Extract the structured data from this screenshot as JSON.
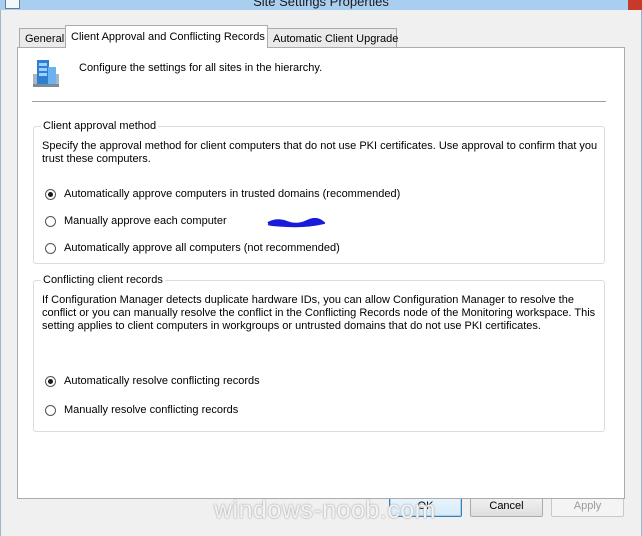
{
  "window": {
    "title": "Site Settings Properties"
  },
  "tabs": [
    {
      "label": "General",
      "active": false
    },
    {
      "label": "Client Approval and Conflicting Records",
      "active": true
    },
    {
      "label": "Automatic Client Upgrade",
      "active": false
    }
  ],
  "header": {
    "icon": "site-settings-icon",
    "text": "Configure the settings for all sites in the hierarchy."
  },
  "approval": {
    "title": "Client approval method",
    "description": "Specify the approval method for client computers that do not use PKI certificates. Use approval to confirm that you trust these computers.",
    "options": [
      {
        "label": "Automatically approve computers in trusted domains (recommended)",
        "checked": true
      },
      {
        "label": "Manually approve each computer",
        "checked": false
      },
      {
        "label": "Automatically approve all computers (not recommended)",
        "checked": false
      }
    ]
  },
  "conflicting": {
    "title": "Conflicting client records",
    "description": "If Configuration Manager detects duplicate hardware IDs, you can allow Configuration Manager to resolve the conflict or you can manually resolve the conflict in the Conflicting Records node of the Monitoring workspace. This setting applies to client computers in workgroups or untrusted domains that do not use PKI certificates.",
    "options": [
      {
        "label": "Automatically resolve conflicting records",
        "checked": true
      },
      {
        "label": "Manually resolve conflicting records",
        "checked": false
      }
    ]
  },
  "buttons": {
    "ok": "OK",
    "cancel": "Cancel",
    "apply": "Apply"
  },
  "watermark": "windows-noob.com",
  "colors": {
    "title_bar": "#a8cff0",
    "dialog_bg": "#f0f0f0",
    "scribble": "#1a1adc"
  }
}
